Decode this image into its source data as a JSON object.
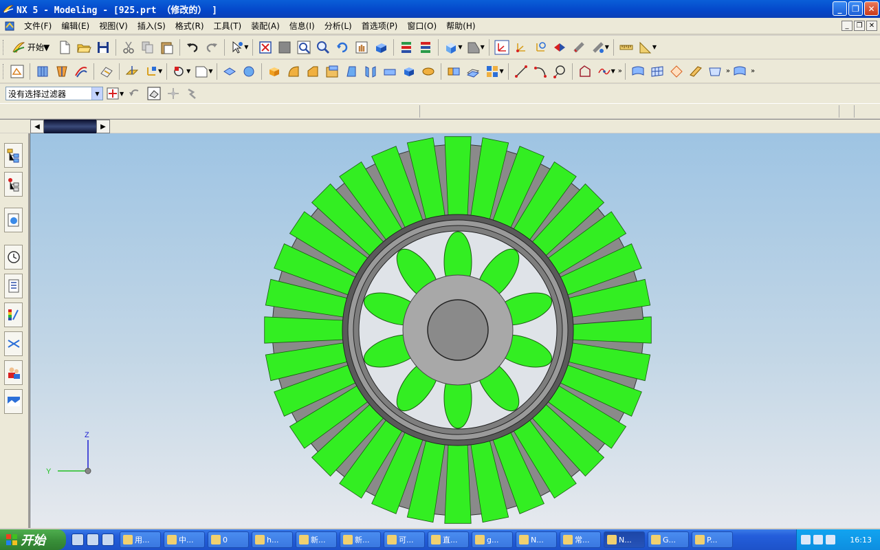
{
  "window": {
    "title": "NX 5 - Modeling - [925.prt （修改的） ]",
    "controls": {
      "minimize": "_",
      "restore": "❐",
      "close": "✕"
    }
  },
  "menu": {
    "items": [
      {
        "label": "文件(F)"
      },
      {
        "label": "编辑(E)"
      },
      {
        "label": "视图(V)"
      },
      {
        "label": "插入(S)"
      },
      {
        "label": "格式(R)"
      },
      {
        "label": "工具(T)"
      },
      {
        "label": "装配(A)"
      },
      {
        "label": "信息(I)"
      },
      {
        "label": "分析(L)"
      },
      {
        "label": "首选项(P)"
      },
      {
        "label": "窗口(O)"
      },
      {
        "label": "帮助(H)"
      }
    ]
  },
  "toolbar": {
    "start_label": "开始",
    "selection_filter": "没有选择过滤器",
    "overflow": "»"
  },
  "triad": {
    "z_label": "Z",
    "y_label": "Y"
  },
  "taskbar": {
    "start_label": "开始",
    "tasks": [
      {
        "label": "用..."
      },
      {
        "label": "中..."
      },
      {
        "label": "0"
      },
      {
        "label": "h..."
      },
      {
        "label": "新..."
      },
      {
        "label": "新..."
      },
      {
        "label": "可..."
      },
      {
        "label": "直..."
      },
      {
        "label": "g..."
      },
      {
        "label": "N..."
      },
      {
        "label": "常..."
      },
      {
        "label": "N..."
      },
      {
        "label": "G..."
      },
      {
        "label": "P..."
      }
    ],
    "clock": "16:13"
  },
  "colors": {
    "gear_green": "#33ee22",
    "gear_gray": "#8a8a8a",
    "title_blue": "#0446c9",
    "taskbar_blue": "#245edb"
  }
}
